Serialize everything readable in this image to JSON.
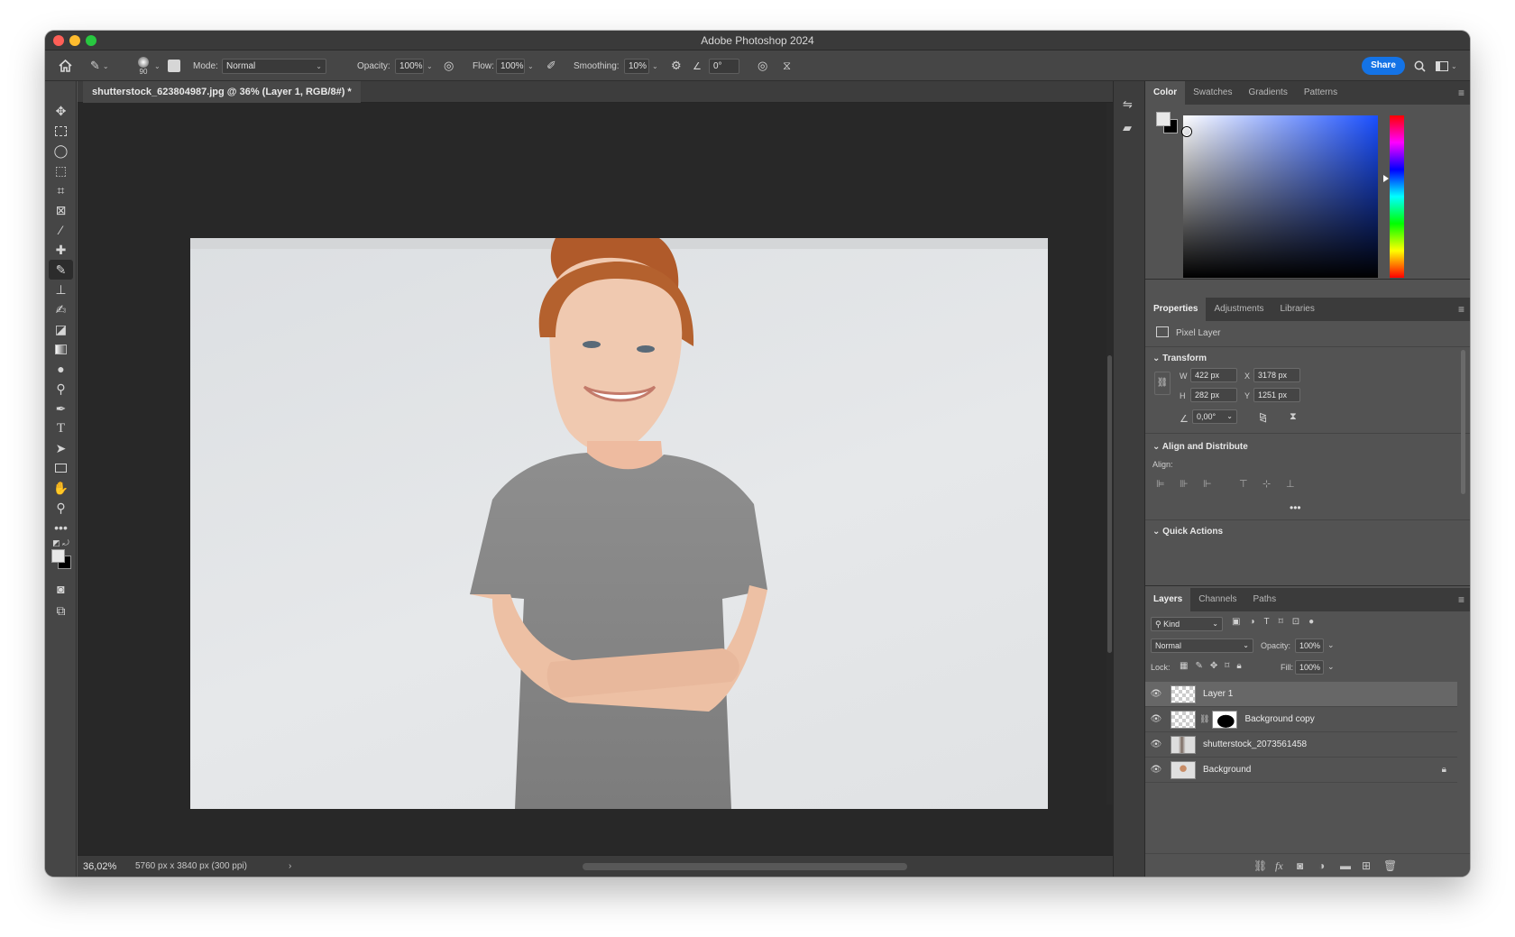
{
  "window": {
    "title": "Adobe Photoshop 2024"
  },
  "options_bar": {
    "brush_size": "90",
    "mode_label": "Mode:",
    "mode_value": "Normal",
    "opacity_label": "Opacity:",
    "opacity_value": "100%",
    "flow_label": "Flow:",
    "flow_value": "100%",
    "smoothing_label": "Smoothing:",
    "smoothing_value": "10%",
    "angle_value": "0°",
    "share_label": "Share"
  },
  "document": {
    "tab_label": "shutterstock_623804987.jpg @ 36% (Layer 1, RGB/8#) *",
    "zoom": "36,02%",
    "dimensions": "5760 px x 3840 px (300 ppi)"
  },
  "color_panel": {
    "tabs": [
      "Color",
      "Swatches",
      "Gradients",
      "Patterns"
    ],
    "active_tab": "Color",
    "foreground_color": "#e8e8e8",
    "background_color": "#000000"
  },
  "properties_panel": {
    "tabs": [
      "Properties",
      "Adjustments",
      "Libraries"
    ],
    "layer_type": "Pixel Layer",
    "transform_heading": "Transform",
    "w_label": "W",
    "w_value": "422 px",
    "h_label": "H",
    "h_value": "282 px",
    "x_label": "X",
    "x_value": "3178 px",
    "y_label": "Y",
    "y_value": "1251 px",
    "angle_value": "0,00°",
    "align_heading": "Align and Distribute",
    "align_label": "Align:",
    "quick_actions_heading": "Quick Actions"
  },
  "layers_panel": {
    "tabs": [
      "Layers",
      "Channels",
      "Paths"
    ],
    "filter_kind": "Kind",
    "blend_mode": "Normal",
    "opacity_label": "Opacity:",
    "opacity_value": "100%",
    "lock_label": "Lock:",
    "fill_label": "Fill:",
    "fill_value": "100%",
    "layers": [
      {
        "name": "Layer 1",
        "selected": true
      },
      {
        "name": "Background copy",
        "selected": false
      },
      {
        "name": "shutterstock_2073561458",
        "selected": false
      },
      {
        "name": "Background",
        "selected": false,
        "locked": true
      }
    ]
  },
  "accent_color": "#1473e6"
}
